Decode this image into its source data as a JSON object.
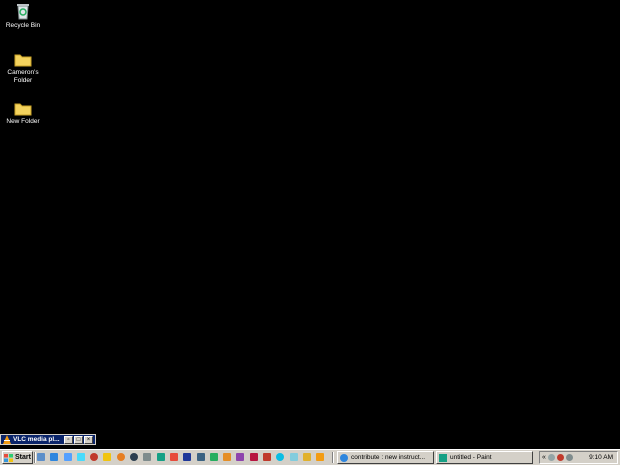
{
  "desktop": {
    "icons": [
      {
        "label": "Recycle Bin",
        "icon": "recycle-bin-icon"
      },
      {
        "label": "Cameron's Folder",
        "icon": "folder-icon"
      },
      {
        "label": "New Folder",
        "icon": "folder-icon"
      }
    ]
  },
  "minimized_window": {
    "title": "VLC media pl...",
    "icon": "vlc-cone-icon",
    "buttons": [
      "restore",
      "maximize",
      "close"
    ]
  },
  "taskbar": {
    "start_label": "Start",
    "quick_launch": [
      "show-desktop-icon",
      "internet-explorer-icon",
      "outlook-icon",
      "media-player-icon",
      "messenger-icon",
      "folder-icon",
      "firefox-icon",
      "vlc-icon",
      "calculator-icon",
      "paint-icon",
      "notepad-icon",
      "photoshop-icon",
      "word-icon",
      "excel-icon",
      "powerpoint-icon",
      "access-icon",
      "acrobat-icon",
      "acrobat-reader-icon",
      "skype-icon",
      "itunes-icon",
      "winamp-icon",
      "vlc-cone-icon"
    ],
    "tasks": [
      {
        "label": "contribute : new instruct...",
        "icon": "internet-explorer-icon"
      },
      {
        "label": "untitled - Paint",
        "icon": "paint-icon"
      }
    ],
    "tray": {
      "chevron": "«",
      "icons": [
        "network-icon",
        "antivirus-icon",
        "volume-icon"
      ],
      "time": "9:10 AM"
    }
  },
  "colors": {
    "desktop_background": "#000000",
    "taskbar": "#d4d0c8",
    "title_bar_active": "#0a246a"
  }
}
